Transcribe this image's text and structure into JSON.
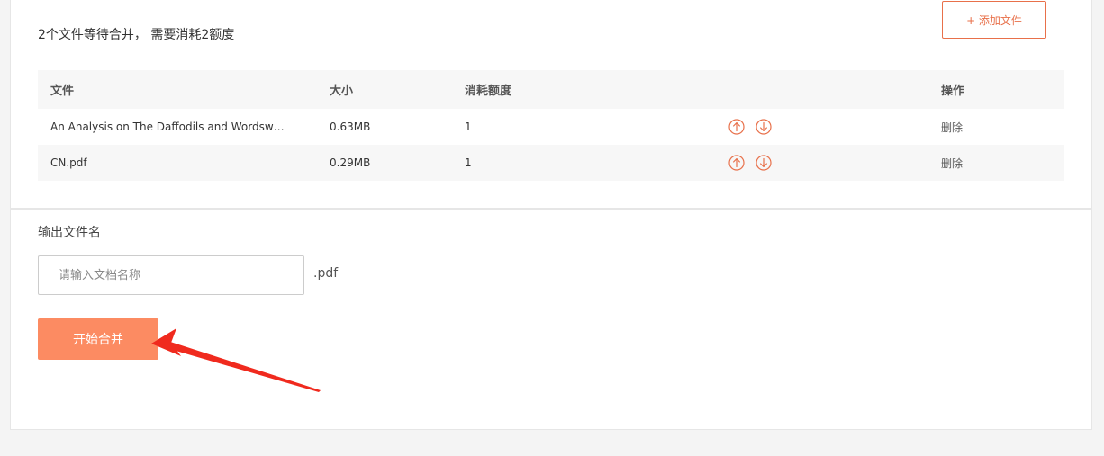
{
  "header": {
    "summary": "2个文件等待合并， 需要消耗2额度",
    "add_button": "+ 添加文件"
  },
  "table": {
    "columns": {
      "name": "文件",
      "size": "大小",
      "cost": "消耗额度",
      "op": "操作"
    },
    "rows": [
      {
        "name": "An Analysis on The Daffodils and Wordswor...",
        "size": "0.63MB",
        "cost": "1",
        "op": "删除"
      },
      {
        "name": "CN.pdf",
        "size": "0.29MB",
        "cost": "1",
        "op": "删除"
      }
    ]
  },
  "output": {
    "label": "输出文件名",
    "placeholder": "请输入文档名称",
    "value": "",
    "extension": ".pdf"
  },
  "actions": {
    "start_label": "开始合并"
  },
  "icons": {
    "move_up": "arrow-up-circle-icon",
    "move_down": "arrow-down-circle-icon"
  },
  "colors": {
    "accent": "#e8704a",
    "start_button": "#fc8b62",
    "annotation_arrow": "#f02a1e",
    "row_alt": "#f7f7f7"
  }
}
